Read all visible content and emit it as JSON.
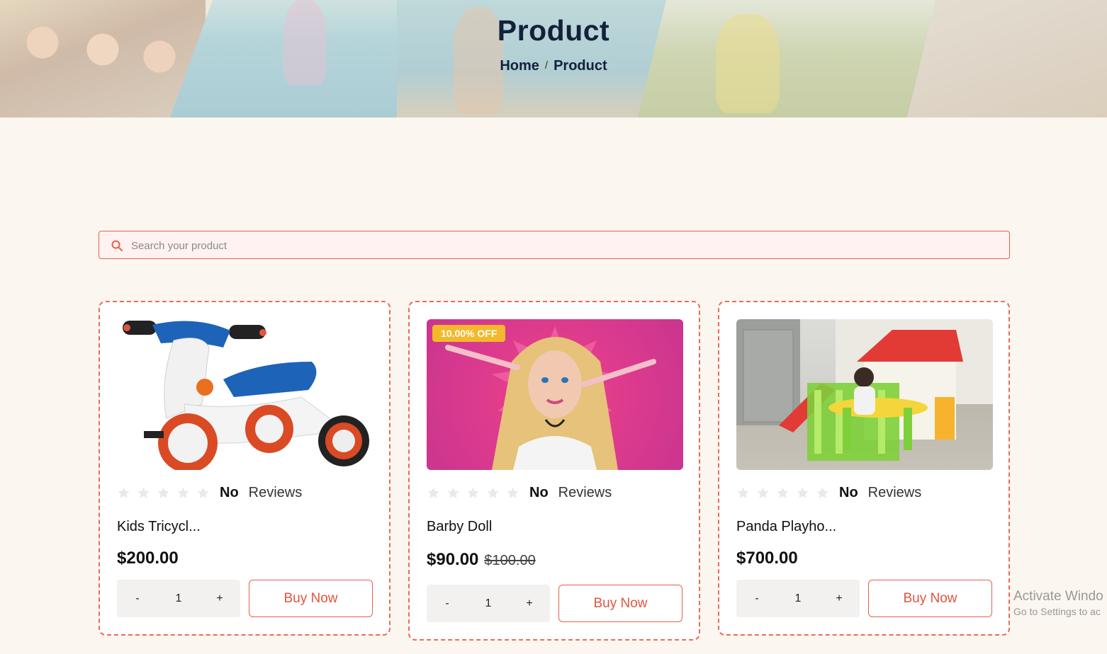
{
  "hero": {
    "title": "Product",
    "breadcrumb": {
      "home": "Home",
      "separator": "/",
      "current": "Product"
    }
  },
  "search": {
    "placeholder": "Search your product",
    "value": ""
  },
  "products": [
    {
      "name": "Kids Tricycl...",
      "price": "$200.00",
      "rating_count_label": "No",
      "reviews_label": "Reviews",
      "rating": 0,
      "max_rating": 5,
      "quantity": "1",
      "minus": "-",
      "plus": "+",
      "buy_label": "Buy Now"
    },
    {
      "name": "Barby Doll",
      "price": "$90.00",
      "old_price": "$100.00",
      "badge": "10.00% OFF",
      "rating_count_label": "No",
      "reviews_label": "Reviews",
      "rating": 0,
      "max_rating": 5,
      "quantity": "1",
      "minus": "-",
      "plus": "+",
      "buy_label": "Buy Now"
    },
    {
      "name": "Panda Playho...",
      "price": "$700.00",
      "rating_count_label": "No",
      "reviews_label": "Reviews",
      "rating": 0,
      "max_rating": 5,
      "quantity": "1",
      "minus": "-",
      "plus": "+",
      "buy_label": "Buy Now"
    }
  ],
  "os_watermark": {
    "line1": "Activate Windo",
    "line2": "Go to Settings to ac"
  },
  "colors": {
    "accent": "#e8604a",
    "badge": "#f4b82b",
    "title": "#14213a",
    "background": "#fbf6ef"
  }
}
